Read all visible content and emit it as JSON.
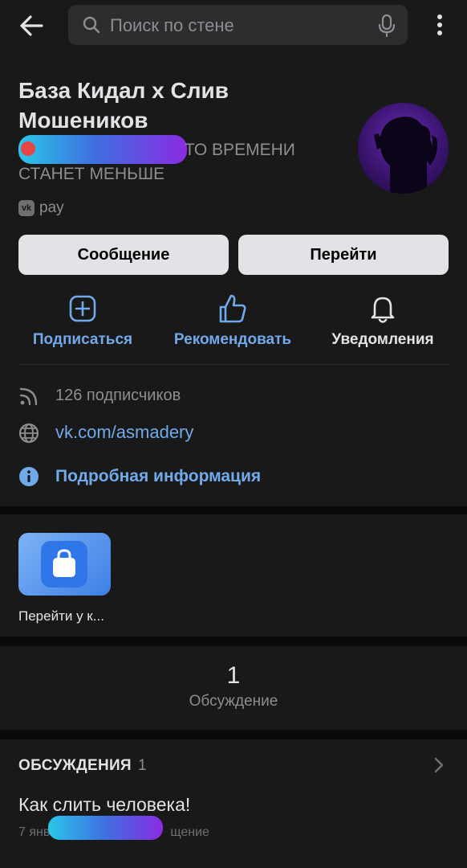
{
  "search": {
    "placeholder": "Поиск по стене"
  },
  "header": {
    "title": "База Кидал х Слив Мошеников",
    "status_visible": "ТО ВРЕМЕНИ СТАНЕТ МЕНЬШЕ",
    "vkpay_label": "pay",
    "vkpay_badge": "vk"
  },
  "buttons": {
    "message": "Сообщение",
    "go": "Перейти"
  },
  "actions": [
    {
      "label": "Подписаться",
      "icon": "plus-square-icon"
    },
    {
      "label": "Рекомендовать",
      "icon": "thumbs-up-icon"
    },
    {
      "label": "Уведомления",
      "icon": "bell-icon"
    }
  ],
  "info": {
    "subscribers": "126 подписчиков",
    "link": "vk.com/asmadery",
    "more": "Подробная информация"
  },
  "shop": {
    "label": "Перейти у к..."
  },
  "counter": {
    "value": "1",
    "label": "Обсуждение"
  },
  "discussions": {
    "title": "ОБСУЖДЕНИЯ",
    "count": "1",
    "topic": "Как слить человека!",
    "meta_left": "7 янв",
    "meta_right": "щение"
  },
  "colors": {
    "accent": "#71aaeb",
    "background": "#19191a",
    "button": "#e1e3e6"
  }
}
